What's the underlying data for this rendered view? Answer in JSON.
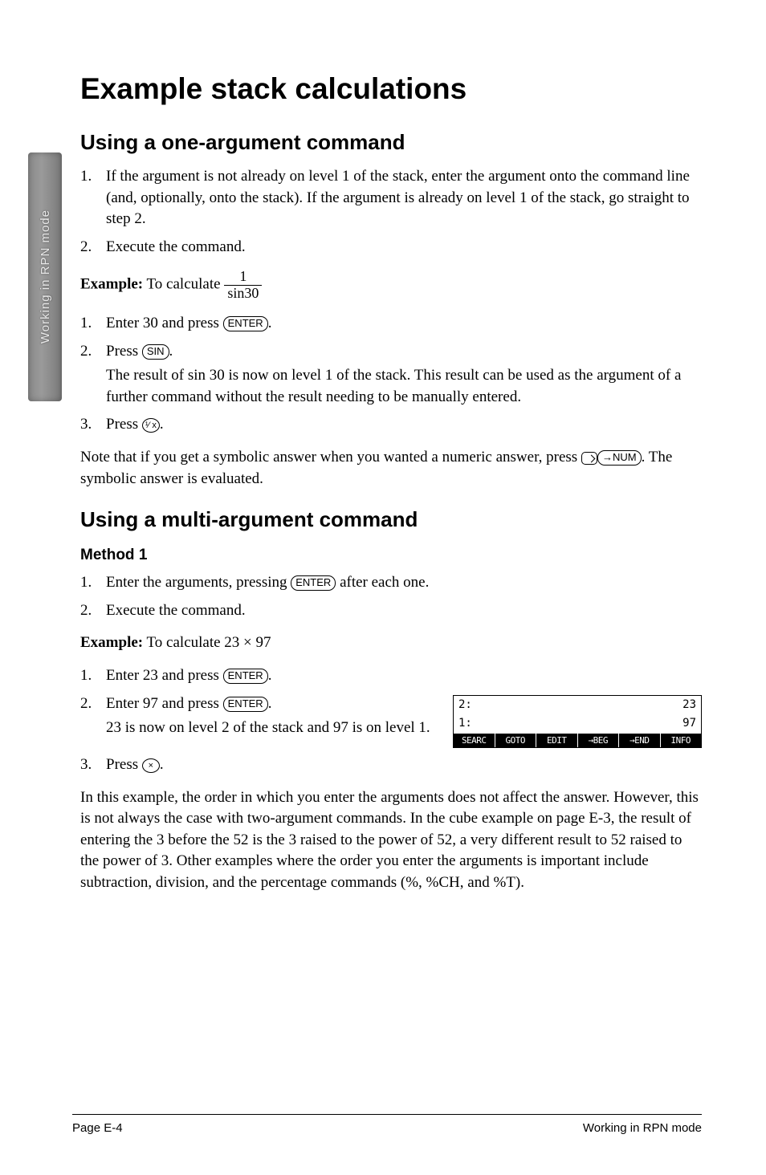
{
  "sideTab": "Working in RPN mode",
  "title": "Example stack calculations",
  "section1": {
    "heading": "Using a one-argument command",
    "steps": [
      {
        "n": "1.",
        "text": "If the argument is not already on level 1 of the stack, enter the argument onto the command line (and, optionally, onto the stack). If the argument is already on level 1 of the stack, go straight to step 2."
      },
      {
        "n": "2.",
        "text": "Execute the command."
      }
    ],
    "exampleLabel": "Example:",
    "exampleText": " To calculate ",
    "fracTop": "1",
    "fracBottom": "sin30",
    "exSteps": {
      "s1n": "1.",
      "s1a": "Enter 30 and press ",
      "s1key": "ENTER",
      "s1b": ".",
      "s2n": "2.",
      "s2a": "Press ",
      "s2key": "SIN",
      "s2b": ".",
      "s2sub": "The result of sin 30 is now on level 1 of the stack. This result can be used as the argument of a further command without the result needing to be manually entered.",
      "s3n": "3.",
      "s3a": "Press ",
      "s3key": "¹⁄ x",
      "s3b": "."
    },
    "note1": "Note that if you get a symbolic answer when you wanted a numeric answer, press ",
    "noteKey": "→NUM",
    "note2": ". The symbolic answer is evaluated."
  },
  "section2": {
    "heading": "Using a multi-argument command",
    "method": "Method 1",
    "steps": {
      "s1n": "1.",
      "s1a": "Enter the arguments, pressing ",
      "s1key": "ENTER",
      "s1b": " after each one.",
      "s2n": "2.",
      "s2a": "Execute the command."
    },
    "exampleLabel": "Example:",
    "exampleText": " To calculate 23 × 97",
    "exSteps": {
      "s1n": "1.",
      "s1a": "Enter 23 and press ",
      "s1key": "ENTER",
      "s1b": ".",
      "s2n": "2.",
      "s2a": "Enter 97 and press ",
      "s2key": "ENTER",
      "s2b": ".",
      "s2sub": "23 is now on level 2 of the stack and 97 is on level 1.",
      "s3n": "3.",
      "s3a": "Press ",
      "s3key": "×",
      "s3b": "."
    },
    "screenshot": {
      "r1l": "2:",
      "r1v": "23",
      "r2l": "1:",
      "r2v": "97",
      "menu": [
        "SEARC",
        "GOTO",
        "EDIT",
        "→BEG",
        "→END",
        "INFO"
      ]
    },
    "para": "In this example, the order in which you enter the arguments does not affect the answer. However, this is not always the case with two-argument commands. In the cube example on page E-3, the result of entering the 3 before the 52 is the 3 raised to the power of 52, a very different result to 52 raised to the power of 3. Other examples where the order you enter the arguments is important include subtraction, division, and the percentage commands (%, %CH, and %T)."
  },
  "footer": {
    "left": "Page E-4",
    "right": "Working in RPN mode"
  }
}
